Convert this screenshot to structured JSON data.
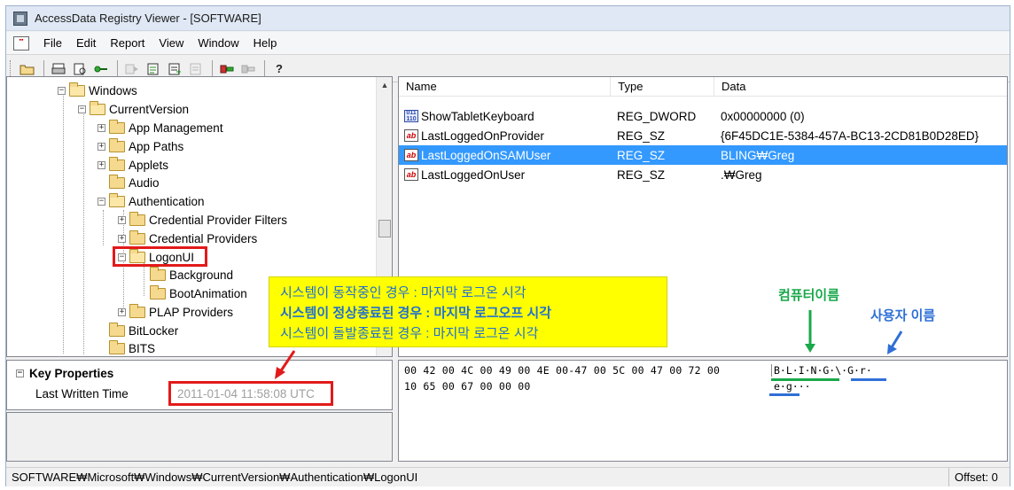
{
  "window": {
    "title": "AccessData Registry Viewer - [SOFTWARE]"
  },
  "menu": [
    "File",
    "Edit",
    "Report",
    "View",
    "Window",
    "Help"
  ],
  "tree": {
    "items": [
      {
        "label": "Windows"
      },
      {
        "label": "CurrentVersion"
      },
      {
        "label": "App Management"
      },
      {
        "label": "App Paths"
      },
      {
        "label": "Applets"
      },
      {
        "label": "Audio"
      },
      {
        "label": "Authentication"
      },
      {
        "label": "Credential Provider Filters"
      },
      {
        "label": "Credential Providers"
      },
      {
        "label": "LogonUI"
      },
      {
        "label": "Background"
      },
      {
        "label": "BootAnimation"
      },
      {
        "label": "PLAP Providers"
      },
      {
        "label": "BitLocker"
      },
      {
        "label": "BITS"
      }
    ]
  },
  "list": {
    "columns": [
      "Name",
      "Type",
      "Data"
    ],
    "rows": [
      {
        "name": "ShowTabletKeyboard",
        "type": "REG_DWORD",
        "data": "0x00000000 (0)"
      },
      {
        "name": "LastLoggedOnProvider",
        "type": "REG_SZ",
        "data": "{6F45DC1E-5384-457A-BC13-2CD81B0D28ED}"
      },
      {
        "name": "LastLoggedOnSAMUser",
        "type": "REG_SZ",
        "data": "BLING₩Greg"
      },
      {
        "name": "LastLoggedOnUser",
        "type": "REG_SZ",
        "data": ".₩Greg"
      }
    ]
  },
  "properties": {
    "header": "Key Properties",
    "row_label": "Last Written Time",
    "row_value": "2011-01-04 11:58:08 UTC"
  },
  "hex": {
    "line1": "00 42 00 4C 00 49 00 4E 00-47 00 5C 00 47 00 72 00",
    "line1_ascii": "B·L·I·N·G·\\·G·r·",
    "line2": "10 65 00 67 00 00 00",
    "line2_ascii": "e·g···"
  },
  "status": {
    "path": "SOFTWARE₩Microsoft₩Windows₩CurrentVersion₩Authentication₩LogonUI",
    "offset": "Offset: 0"
  },
  "annotations": {
    "callout_line1": "시스템이 동작중인 경우 : 마지막 로그온 시각",
    "callout_line2": "시스템이 정상종료된 경우 : 마지막 로그오프 시각",
    "callout_line3": "시스템이 돌발종료된 경우 : 마지막 로그온 시각",
    "computer_name_label": "컴퓨터이름",
    "user_name_label": "사용자 이름"
  },
  "colors": {
    "highlight_red": "#e21a1a",
    "selection_blue": "#3399ff",
    "callout_yellow": "#ffff00",
    "label_green": "#1aa84a",
    "label_blue": "#2f6fd6"
  }
}
